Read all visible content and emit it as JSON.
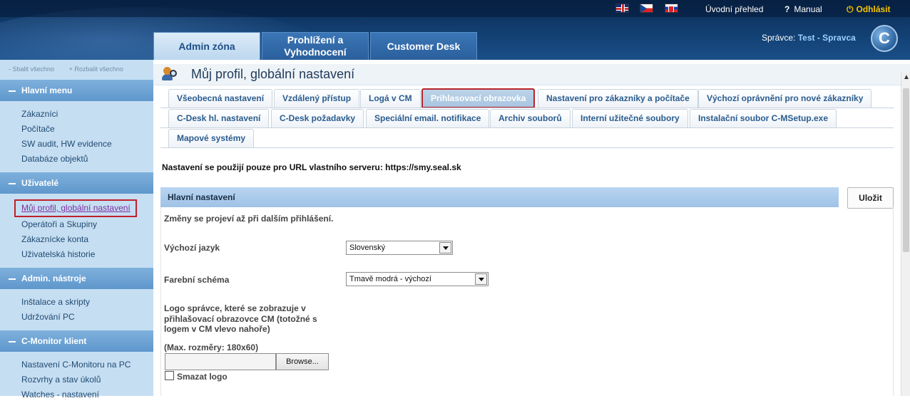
{
  "header": {
    "flags": [
      "uk-flag-icon",
      "cz-flag-icon",
      "sk-flag-icon"
    ],
    "links": {
      "overview": "Úvodní přehled",
      "manual": "Manual",
      "logout": "Odhlásit"
    },
    "main_tabs": [
      {
        "label": "Admin zóna",
        "active": true
      },
      {
        "label": "Prohlížení a Vyhodnocení",
        "active": false
      },
      {
        "label": "Customer Desk",
        "active": false
      }
    ],
    "admin_prefix": "Správce:",
    "admin_name": "Test - Spravca",
    "logo_letter": "C"
  },
  "sidebar": {
    "collapse_all": "- Sbalit všechno",
    "expand_all": "+ Rozbalit všechno",
    "sections": [
      {
        "title": "Hlavní menu",
        "items": [
          "Zákazníci",
          "Počítače",
          "SW audit, HW evidence",
          "Databáze objektů"
        ]
      },
      {
        "title": "Uživatelé",
        "items": [
          "Můj profil, globální nastavení",
          "Operátoři a Skupiny",
          "Zákaznícke konta",
          "Uživatelská historie"
        ]
      },
      {
        "title": "Admin. nástroje",
        "items": [
          "Inštalace a skripty",
          "Udržování PC"
        ]
      },
      {
        "title": "C-Monitor klient",
        "items": [
          "Nastavení C-Monitoru na PC",
          "Rozvrhy a stav úkolů",
          "Watches - nastavení"
        ]
      }
    ],
    "active_item": "Můj profil, globální nastavení"
  },
  "main": {
    "page_title": "Můj profil, globální nastavení",
    "tabs_row1": [
      "Všeobecná nastavení",
      "Vzdálený přístup",
      "Logá v CM",
      "Prihlasovací obrazovka",
      "Nastavení pro zákazníky a počítače",
      "Výchozí oprávnění pro nové zákazníky"
    ],
    "tabs_row2": [
      "C-Desk hl. nastavení",
      "C-Desk požadavky",
      "Speciální email. notifikace",
      "Archiv souborů",
      "Interní užitečné soubory",
      "Instalační soubor C-MSetup.exe"
    ],
    "tabs_row3": [
      "Mapové systémy"
    ],
    "active_tab": "Prihlasovací obrazovka",
    "info_text": "Nastavení se použijí pouze pro URL vlastního serveru: https://smy.seal.sk",
    "section_title": "Hlavní nastavení",
    "save_label": "Uložit",
    "note": "Změny se projeví až při dalším přihlášení.",
    "fields": {
      "language_label": "Výchozí jazyk",
      "language_value": "Slovenský",
      "color_label": "Farební schéma",
      "color_value": "Tmavě modrá - výchozí",
      "logo_label_1": "Logo správce, které se zobrazuje v",
      "logo_label_2": "přihlašovací obrazovce CM (totožné s",
      "logo_label_3": "logem v CM vlevo nahoře)",
      "logo_size": "(Max. rozměry: 180x60)",
      "browse_label": "Browse...",
      "delete_logo_label": "Smazat logo"
    }
  }
}
